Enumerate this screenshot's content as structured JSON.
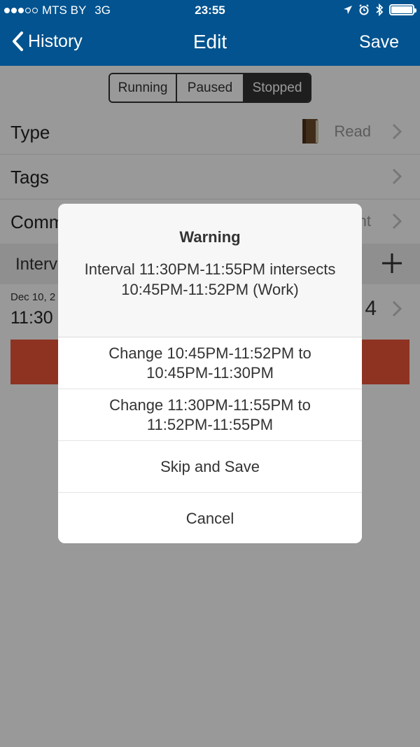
{
  "status_bar": {
    "carrier": "MTS BY",
    "network": "3G",
    "time": "23:55"
  },
  "nav": {
    "back_label": "History",
    "title": "Edit",
    "save_label": "Save"
  },
  "segmented": {
    "options": [
      "Running",
      "Paused",
      "Stopped"
    ],
    "selected": "Stopped"
  },
  "rows": {
    "type_label": "Type",
    "type_value": "Read",
    "tags_label": "Tags",
    "comment_label": "Comm",
    "comment_value": "nt"
  },
  "intervals": {
    "header_label": "Interv",
    "date": "Dec 10, 2",
    "time": "11:30 I",
    "duration": "4"
  },
  "alert": {
    "title": "Warning",
    "message": "Interval 11:30PM-11:55PM intersects 10:45PM-11:52PM (Work)",
    "buttons": [
      "Change 10:45PM-11:52PM to 10:45PM-11:30PM",
      "Change 11:30PM-11:55PM to 11:52PM-11:55PM",
      "Skip and Save",
      "Cancel"
    ]
  },
  "colors": {
    "nav_bg": "#02538f",
    "segment_active": "#333333",
    "interval_bar": "#ed5437"
  }
}
